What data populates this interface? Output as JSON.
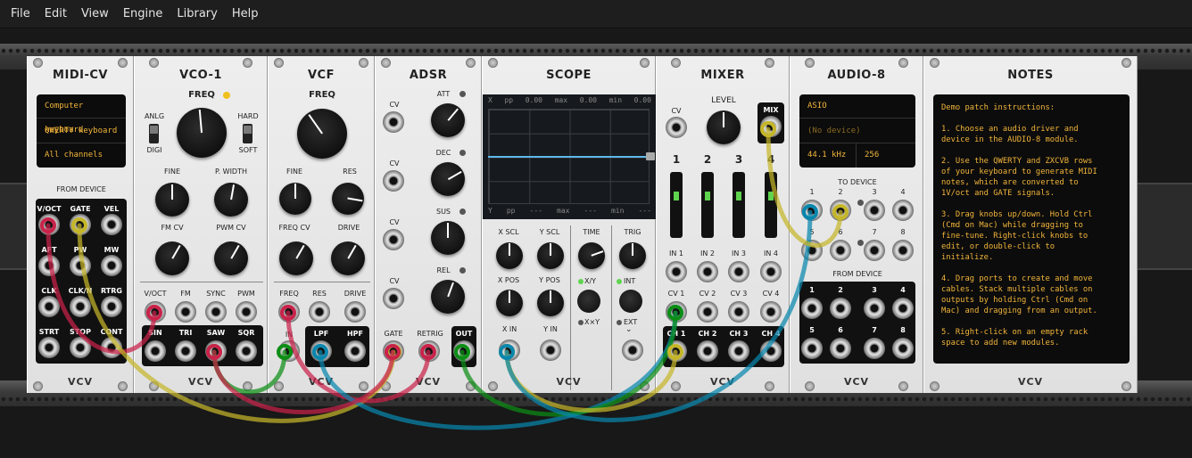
{
  "menu": [
    "File",
    "Edit",
    "View",
    "Engine",
    "Library",
    "Help"
  ],
  "brand": "VCV",
  "midicv": {
    "title": "MIDI-CV",
    "screen": [
      "Computer keyboard",
      "QWERTY keyboard",
      "All channels"
    ],
    "section": "FROM DEVICE",
    "ports": [
      "V/OCT",
      "GATE",
      "VEL",
      "AFT",
      "PW",
      "MW",
      "CLK",
      "CLK/N",
      "RTRG",
      "STRT",
      "STOP",
      "CONT"
    ]
  },
  "vco": {
    "title": "VCO-1",
    "freq": "FREQ",
    "anlg": "ANLG",
    "digi": "DIGI",
    "hard": "HARD",
    "soft": "SOFT",
    "fine": "FINE",
    "pwidth": "P. WIDTH",
    "fmcv": "FM CV",
    "pwmcv": "PWM CV",
    "inputs": [
      "V/OCT",
      "FM",
      "SYNC",
      "PWM"
    ],
    "outputs": [
      "SIN",
      "TRI",
      "SAW",
      "SQR"
    ]
  },
  "vcf": {
    "title": "VCF",
    "freq": "FREQ",
    "fine": "FINE",
    "res": "RES",
    "freqcv": "FREQ CV",
    "drive": "DRIVE",
    "inputs": [
      "FREQ",
      "RES",
      "DRIVE"
    ],
    "in": "IN",
    "outputs": [
      "LPF",
      "HPF"
    ]
  },
  "adsr": {
    "title": "ADSR",
    "cv": "CV",
    "att": "ATT",
    "dec": "DEC",
    "sus": "SUS",
    "rel": "REL",
    "gate": "GATE",
    "retrig": "RETRIG",
    "out": "OUT"
  },
  "scope": {
    "title": "SCOPE",
    "header_top": [
      "X",
      "pp",
      "0.00",
      "max",
      "0.00",
      "min",
      "0.00"
    ],
    "header_bottom": [
      "Y",
      "pp",
      "---",
      "max",
      "---",
      "min",
      "---"
    ],
    "xscl": "X SCL",
    "yscl": "Y SCL",
    "time": "TIME",
    "trig": "TRIG",
    "xpos": "X POS",
    "ypos": "Y POS",
    "xy": "X/Y",
    "xxy": "X×Y",
    "int": "INT",
    "ext": "EXT",
    "xin": "X IN",
    "yin": "Y IN"
  },
  "mixer": {
    "title": "MIXER",
    "cv": "CV",
    "level": "LEVEL",
    "mix": "MIX",
    "channels": [
      "1",
      "2",
      "3",
      "4"
    ],
    "ins": [
      "IN 1",
      "IN 2",
      "IN 3",
      "IN 4"
    ],
    "cvs": [
      "CV 1",
      "CV 2",
      "CV 3",
      "CV 4"
    ],
    "chs": [
      "CH 1",
      "CH 2",
      "CH 3",
      "CH 4"
    ]
  },
  "audio": {
    "title": "AUDIO-8",
    "screen": [
      "ASIO",
      "(No device)",
      "44.1 kHz",
      "256"
    ],
    "to": "TO DEVICE",
    "from": "FROM DEVICE",
    "nums": [
      "1",
      "2",
      "3",
      "4",
      "5",
      "6",
      "7",
      "8"
    ]
  },
  "notes": {
    "title": "NOTES",
    "text": "Demo patch instructions:\n\n1. Choose an audio driver and\ndevice in the AUDIO-8 module.\n\n2. Use the QWERTY and ZXCVB rows\nof your keyboard to generate MIDI\nnotes, which are converted to\n1V/oct and GATE signals.\n\n3. Drag knobs up/down. Hold Ctrl\n(Cmd on Mac) while dragging to\nfine-tune. Right-click knobs to\nedit, or double-click to\ninitialize.\n\n4. Drag ports to create and move\ncables. Stack multiple cables on\noutputs by holding Ctrl (Cmd on\nMac) and dragging from an output.\n\n5. Right-click on an empty rack\nspace to add new modules."
  },
  "cable_colors": {
    "red": "#c9234a",
    "yellow": "#c5b629",
    "green": "#0c8e15",
    "blue": "#0986ad"
  }
}
